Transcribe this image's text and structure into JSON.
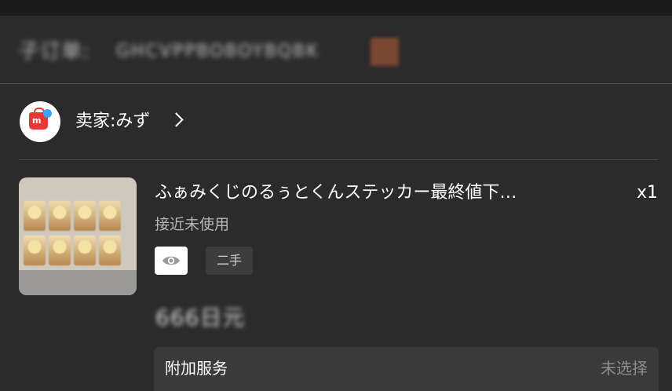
{
  "order": {
    "label": "子订单:",
    "number": "GHCVPPBOBOYBQBK",
    "copy_icon": "copy-icon",
    "copy_icon_color": "#7a4732"
  },
  "seller": {
    "label": "卖家:みず",
    "avatar_icon": "mercari-bag-icon",
    "avatar_color": "#e53935"
  },
  "product": {
    "title": "ふぁみくじのるぅとくんステッカー最終値下…",
    "quantity": "x1",
    "condition": "接近未使用",
    "view_icon": "eye-icon",
    "tag": "二手",
    "price": "666日元"
  },
  "service": {
    "label": "附加服务",
    "value": "未选择"
  }
}
